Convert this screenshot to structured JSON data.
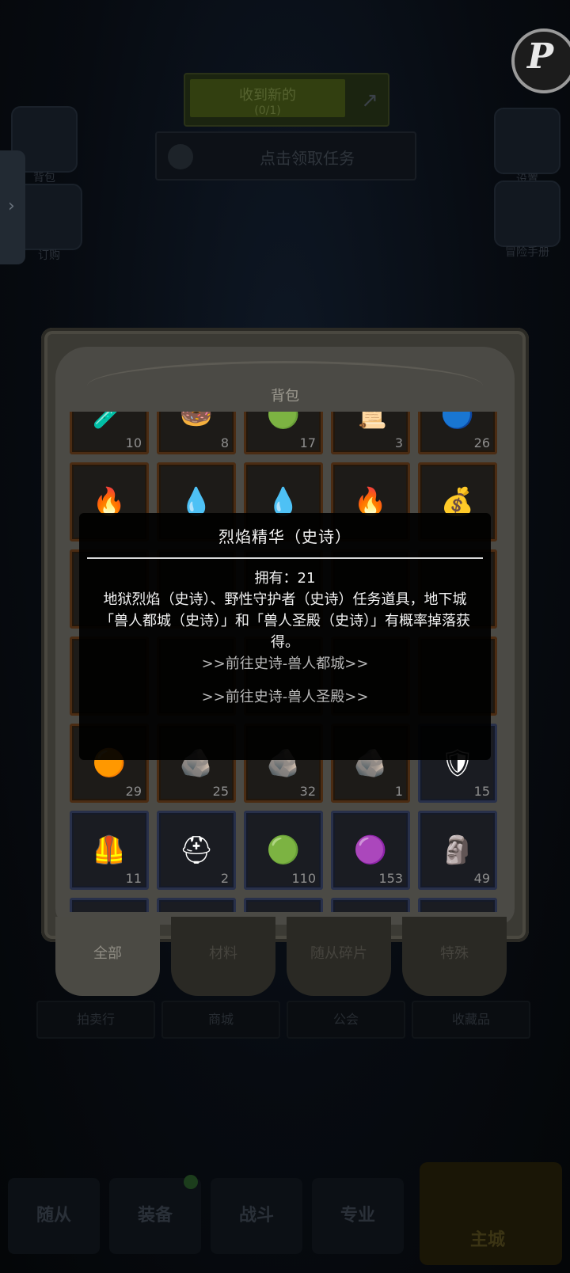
{
  "hud": {
    "quest_line1": "收到新的",
    "quest_line2": "(0/1)",
    "task_text": "点击领取任务",
    "left_top_label": "背包",
    "left_bottom_label": "订购",
    "right_top_label": "设置",
    "right_bottom_label": "冒险手册",
    "badge_letter": "P"
  },
  "backpack": {
    "title": "背包",
    "rows": [
      [
        {
          "icon": "🧪",
          "count": "10",
          "frame": "orange"
        },
        {
          "icon": "🍩",
          "count": "8",
          "frame": "orange"
        },
        {
          "icon": "🟢",
          "count": "17",
          "frame": "orange"
        },
        {
          "icon": "📜",
          "count": "3",
          "frame": "orange"
        },
        {
          "icon": "🔵",
          "count": "26",
          "frame": "orange"
        }
      ],
      [
        {
          "icon": "🔥",
          "count": "",
          "frame": "orange"
        },
        {
          "icon": "💧",
          "count": "",
          "frame": "orange"
        },
        {
          "icon": "💧",
          "count": "",
          "frame": "orange"
        },
        {
          "icon": "🔥",
          "count": "",
          "frame": "orange"
        },
        {
          "icon": "💰",
          "count": "",
          "frame": "orange"
        }
      ],
      [
        {
          "icon": "",
          "count": "",
          "frame": "orange"
        },
        {
          "icon": "",
          "count": "",
          "frame": "orange"
        },
        {
          "icon": "",
          "count": "",
          "frame": "orange"
        },
        {
          "icon": "",
          "count": "",
          "frame": "orange"
        },
        {
          "icon": "",
          "count": "",
          "frame": "orange"
        }
      ],
      [
        {
          "icon": "",
          "count": "",
          "frame": "orange"
        },
        {
          "icon": "",
          "count": "",
          "frame": "orange"
        },
        {
          "icon": "",
          "count": "",
          "frame": "orange"
        },
        {
          "icon": "",
          "count": "",
          "frame": "orange"
        },
        {
          "icon": "",
          "count": "",
          "frame": "orange"
        }
      ],
      [
        {
          "icon": "🟠",
          "count": "29",
          "frame": "orange"
        },
        {
          "icon": "🪨",
          "count": "25",
          "frame": "orange"
        },
        {
          "icon": "🪨",
          "count": "32",
          "frame": "orange"
        },
        {
          "icon": "🪨",
          "count": "1",
          "frame": "orange"
        },
        {
          "icon": "🛡",
          "count": "15",
          "frame": "blue"
        }
      ],
      [
        {
          "icon": "🦺",
          "count": "11",
          "frame": "blue"
        },
        {
          "icon": "⛑",
          "count": "2",
          "frame": "blue"
        },
        {
          "icon": "🟢",
          "count": "110",
          "frame": "blue"
        },
        {
          "icon": "🟣",
          "count": "153",
          "frame": "blue"
        },
        {
          "icon": "🗿",
          "count": "49",
          "frame": "blue"
        }
      ],
      [
        {
          "icon": "",
          "count": "",
          "frame": "blue"
        },
        {
          "icon": "",
          "count": "",
          "frame": "blue"
        },
        {
          "icon": "",
          "count": "",
          "frame": "blue"
        },
        {
          "icon": "",
          "count": "",
          "frame": "blue"
        },
        {
          "icon": "",
          "count": "",
          "frame": "blue"
        }
      ]
    ],
    "tabs": [
      "全部",
      "材料",
      "随从碎片",
      "特殊"
    ],
    "under_buttons": [
      "拍卖行",
      "商城",
      "公会",
      "收藏品"
    ]
  },
  "tooltip": {
    "title": "烈焰精华（史诗）",
    "owned": "拥有：21",
    "description": "地狱烈焰（史诗）、野性守护者（史诗）任务道具，地下城「兽人都城（史诗）」和「兽人圣殿（史诗）」有概率掉落获得。",
    "link1": ">>前往史诗-兽人都城>>",
    "link2": ">>前往史诗-兽人圣殿>>"
  },
  "bottom_nav": [
    "随从",
    "装备",
    "战斗",
    "专业",
    "主城"
  ]
}
